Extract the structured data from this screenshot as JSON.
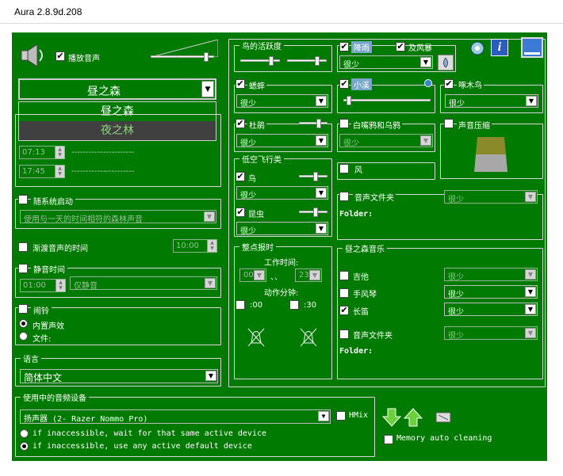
{
  "title": "Aura 2.8.9d.208",
  "sound": {
    "play_label": "播放音声"
  },
  "preset": {
    "selected": "昼之森",
    "options": [
      "昼之森",
      "夜之林"
    ]
  },
  "autostart": {
    "label": "随系统启动",
    "dropdown": "使用与一天的时间相符的森林声音"
  },
  "fade": {
    "label": "渐渡音声的时间",
    "value": "10:00"
  },
  "mute": {
    "label": "静音时间",
    "time": "01:00",
    "mode": "仅静音"
  },
  "alarm": {
    "label": "闹铃",
    "opt1": "内置声效",
    "opt2": "文件:"
  },
  "language": {
    "label": "语言",
    "value": "简体中文"
  },
  "audio": {
    "label": "使用中的音频设备",
    "device": "扬声器 (2- Razer Nommo Pro)",
    "hmix": "HMix",
    "opt1": "if inaccessible, wait for that same active device",
    "opt2": "if inaccessible, use any active default device",
    "memory": "Memory auto cleaning"
  },
  "times": {
    "t1": "07:13",
    "t2": "17:45",
    "dash1": "----------------------",
    "dash2": "----------------------"
  },
  "birds": {
    "label": "鸟的活跃度"
  },
  "cricket": {
    "label": "蟋蟀",
    "value": "很少"
  },
  "cuckoo": {
    "label": "杜鹃",
    "value": "很少"
  },
  "fly": {
    "label": "低空飞行类",
    "bird": "鸟",
    "bird_value": "很少",
    "insect": "昆虫",
    "insect_value": "很少"
  },
  "hourly": {
    "label": "整点报时",
    "work": "工作时间:",
    "from": "00",
    "to": "23",
    "sep": "、、",
    "action": "动作分钟:",
    "m0": ":00",
    "m30": ":30"
  },
  "rain": {
    "label": "降雨",
    "storm": "及风暴",
    "value": "很少"
  },
  "stream": {
    "label": "小溪"
  },
  "woodpecker": {
    "label": "啄木鸟",
    "value": "很少"
  },
  "whitebird": {
    "label": "白嘴鸦和乌鸦",
    "value": "很少"
  },
  "compress": {
    "label": "声音压缩"
  },
  "wind": {
    "label": "风"
  },
  "soundfolder": {
    "label": "音声文件夹",
    "value": "很少",
    "folder": "Folder:"
  },
  "music": {
    "label": "昼之森音乐",
    "guitar": "吉他",
    "accordion": "手风琴",
    "flute": "长笛",
    "folder_label": "音声文件夹",
    "folder": "Folder:",
    "v1": "很少",
    "v2": "很少",
    "v3": "很少",
    "v4": "很少"
  }
}
